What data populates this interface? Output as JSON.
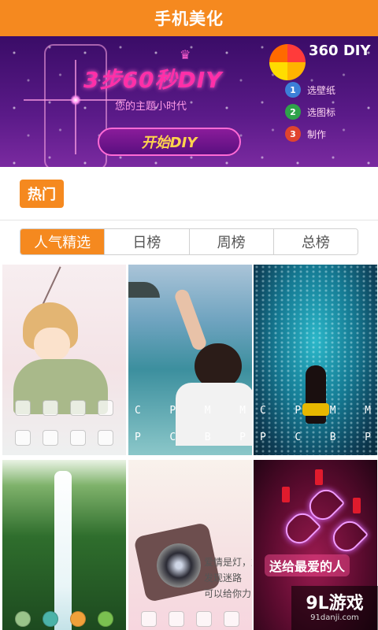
{
  "titlebar": {
    "title": "手机美化"
  },
  "banner": {
    "headline": "3步60秒DIY",
    "subline": "您的主题小时代",
    "start_label": "开始DIY",
    "logo_text": "360 DIY",
    "steps": [
      {
        "num": "1",
        "label": "选壁纸",
        "color": "#3c7fd8"
      },
      {
        "num": "2",
        "label": "选图标",
        "color": "#2fa24a"
      },
      {
        "num": "3",
        "label": "制作",
        "color": "#e0442e"
      }
    ]
  },
  "hot": {
    "label": "热门"
  },
  "tabs": [
    {
      "label": "人气精选",
      "active": true
    },
    {
      "label": "日榜",
      "active": false
    },
    {
      "label": "周榜",
      "active": false
    },
    {
      "label": "总榜",
      "active": false
    }
  ],
  "themes": [
    {
      "name": "anime-boy-theme"
    },
    {
      "name": "sea-girl-theme",
      "letters_top": [
        "C",
        "P",
        "M",
        "M"
      ],
      "letters_bottom": [
        "P",
        "C",
        "B",
        "P"
      ]
    },
    {
      "name": "aquarium-theme",
      "letters_top": [
        "C",
        "P",
        "M",
        "M"
      ],
      "letters_bottom": [
        "P",
        "C",
        "B",
        "P"
      ]
    },
    {
      "name": "waterfall-theme"
    },
    {
      "name": "camera-quote-theme",
      "quote": "爱情是灯，友\n发现迷路\n可以给你力"
    },
    {
      "name": "love-hearts-theme",
      "banner_text": "送给最爱的人"
    }
  ],
  "watermark": {
    "brand": "9L游戏",
    "site": "91danji.com"
  },
  "colors": {
    "accent": "#f5891f",
    "banner_bg": "#4a1478"
  }
}
